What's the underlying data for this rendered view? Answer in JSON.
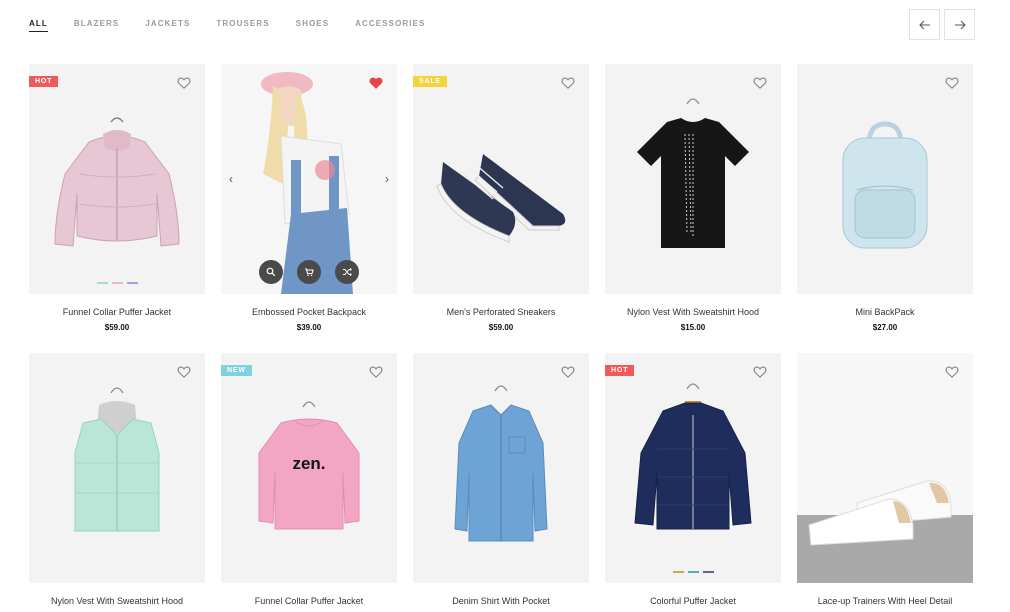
{
  "filters": [
    {
      "label": "ALL",
      "active": true
    },
    {
      "label": "BLAZERS",
      "active": false
    },
    {
      "label": "JACKETS",
      "active": false
    },
    {
      "label": "TROUSERS",
      "active": false
    },
    {
      "label": "SHOES",
      "active": false
    },
    {
      "label": "ACCESSORIES",
      "active": false
    }
  ],
  "nav": {
    "prev_icon": "arrow-left-icon",
    "next_icon": "arrow-right-icon"
  },
  "colors": {
    "hot": "#f05a5a",
    "sale": "#f7d33b",
    "new": "#7fd3df",
    "heart_active": "#e8434a"
  },
  "products": [
    {
      "name": "Funnel Collar Puffer Jacket",
      "price": "$59.00",
      "badge": "HOT",
      "liked": false,
      "swatches": [
        "#a9dcd0",
        "#f3b7c6",
        "#9fa6d6"
      ],
      "image": "pink-puffer-jacket"
    },
    {
      "name": "Embossed Pocket Backpack",
      "price": "$39.00",
      "badge": "",
      "liked": true,
      "carousel": true,
      "actions": [
        "search-icon",
        "cart-icon",
        "shuffle-icon"
      ],
      "image": "model-overalls"
    },
    {
      "name": "Men's Perforated Sneakers",
      "price": "$59.00",
      "badge": "SALE",
      "liked": false,
      "image": "navy-sneakers"
    },
    {
      "name": "Nylon Vest With Sweatshirt Hood",
      "price": "$15.00",
      "badge": "",
      "liked": false,
      "image": "black-tshirt"
    },
    {
      "name": "Mini BackPack",
      "price": "$27.00",
      "badge": "",
      "liked": false,
      "image": "silver-backpack"
    },
    {
      "name": "Nylon Vest With Sweatshirt Hood",
      "price": "",
      "badge": "",
      "liked": false,
      "image": "mint-vest"
    },
    {
      "name": "Funnel Collar Puffer Jacket",
      "price": "",
      "badge": "NEW",
      "liked": false,
      "image": "pink-sweatshirt",
      "print": "zen."
    },
    {
      "name": "Denim Shirt With Pocket",
      "price": "",
      "badge": "",
      "liked": false,
      "image": "denim-shirt"
    },
    {
      "name": "Colorful Puffer Jacket",
      "price": "",
      "badge": "HOT",
      "liked": false,
      "swatches": [
        "#c9a65a",
        "#5aa9b5",
        "#5f6a8a"
      ],
      "image": "navy-puffer-jacket"
    },
    {
      "name": "Lace-up Trainers With Heel Detail",
      "price": "",
      "badge": "",
      "liked": false,
      "image": "white-trainers"
    }
  ]
}
